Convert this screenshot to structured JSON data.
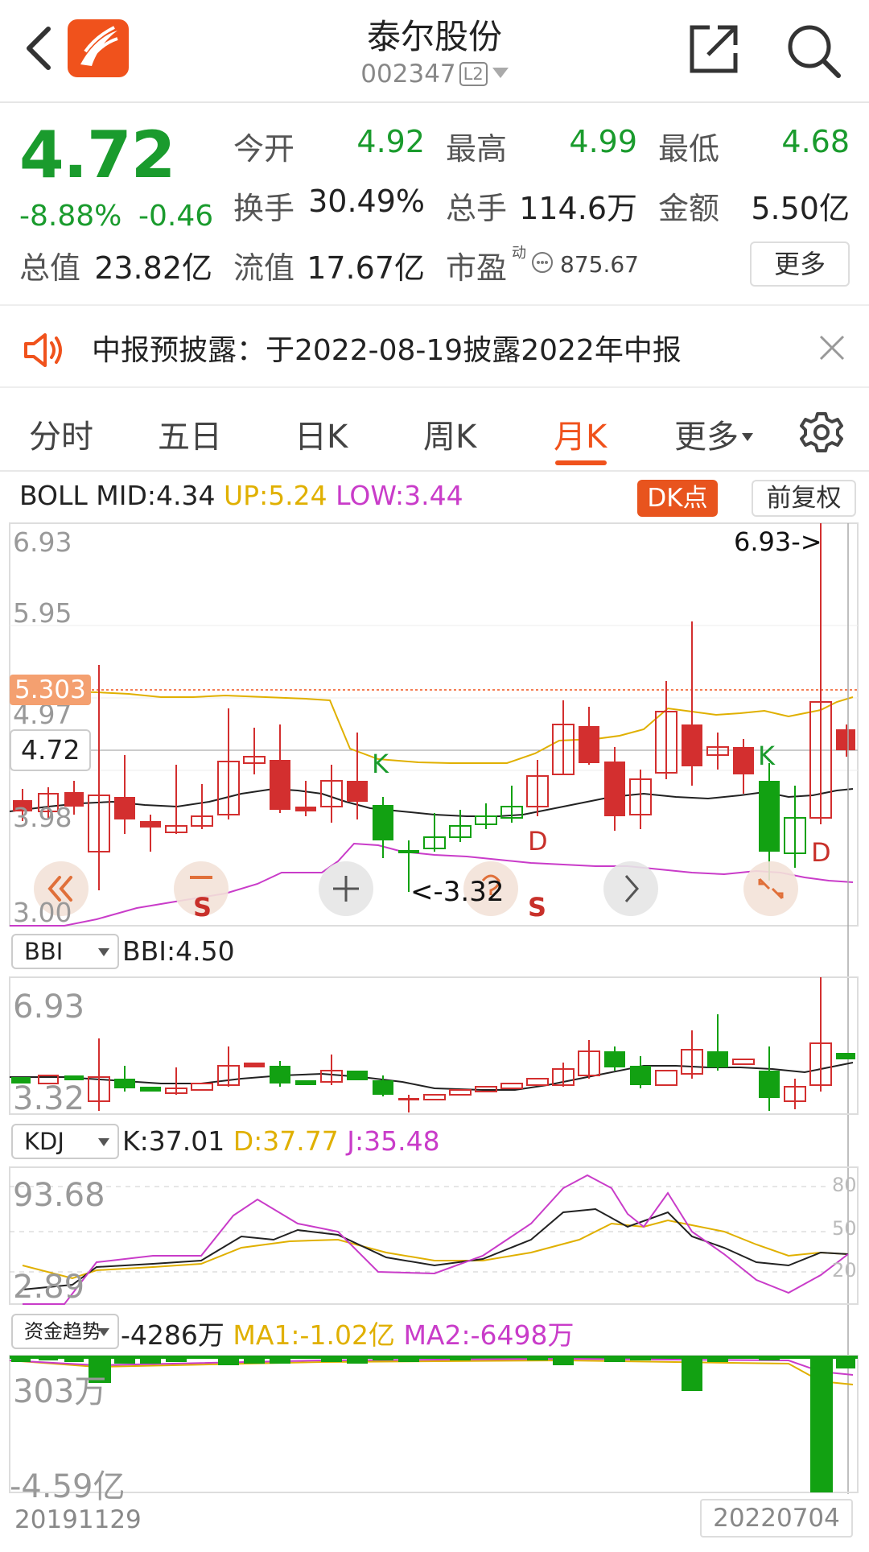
{
  "header": {
    "title": "泰尔股份",
    "code": "002347",
    "level": "L2"
  },
  "quote": {
    "price": "4.72",
    "change_pct": "-8.88%",
    "change_abs": "-0.46",
    "open_label": "今开",
    "open_value": "4.92",
    "high_label": "最高",
    "high_value": "4.99",
    "low_label": "最低",
    "low_value": "4.68",
    "turnover_label": "换手",
    "turnover_value": "30.49%",
    "volume_label": "总手",
    "volume_value": "114.6万",
    "amount_label": "金额",
    "amount_value": "5.50亿",
    "mktcap_label": "总值",
    "mktcap_value": "23.82亿",
    "float_label": "流值",
    "float_value": "17.67亿",
    "pe_label": "市盈",
    "pe_superscript": "动",
    "pe_value": "875.67",
    "more_label": "更多"
  },
  "notice": {
    "text": "中报预披露：于2022-08-19披露2022年中报"
  },
  "tabs": {
    "items": [
      "分时",
      "五日",
      "日K",
      "周K",
      "月K",
      "更多"
    ],
    "active": "月K"
  },
  "boll": {
    "mid_label": "BOLL MID:4.34",
    "up_label": "UP:5.24",
    "low_label": "LOW:3.44",
    "dk_button": "DK点",
    "fq_button": "前复权"
  },
  "main_chart": {
    "y_ticks": [
      "6.93",
      "5.95",
      "4.97",
      "3.98",
      "3.00"
    ],
    "current_price_tag": "4.72",
    "ref_tag": "5.303",
    "high_marker": "6.93->",
    "low_marker": "<-3.32",
    "signals": [
      {
        "text": "K",
        "color": "#1a9b2d"
      },
      {
        "text": "D",
        "color": "#c8302a"
      },
      {
        "text": "S",
        "color": "#c8302a"
      },
      {
        "text": "K",
        "color": "#1a9b2d"
      },
      {
        "text": "D",
        "color": "#c8302a"
      },
      {
        "text": "S",
        "color": "#c8302a"
      }
    ]
  },
  "bbi": {
    "selector": "BBI",
    "value_label": "BBI:4.50",
    "y_top": "6.93",
    "y_bottom": "3.32"
  },
  "kdj": {
    "selector": "KDJ",
    "k_label": "K:37.01",
    "d_label": "D:37.77",
    "j_label": "J:35.48",
    "y_top": "93.68",
    "y_bottom": "2.89",
    "levels": [
      "80",
      "50",
      "20"
    ]
  },
  "fund": {
    "selector": "资金趋势",
    "value_label": "-4286万",
    "ma1_label": "MA1:-1.02亿",
    "ma2_label": "MA2:-6498万",
    "y_top": "303万",
    "y_bottom": "-4.59亿"
  },
  "dates": {
    "start": "20191129",
    "end": "20220704"
  },
  "colors": {
    "up": "#d32f2f",
    "down": "#12a112",
    "accent": "#f0521c",
    "boll_up": "#e0b000",
    "boll_low": "#c93cc9"
  }
}
